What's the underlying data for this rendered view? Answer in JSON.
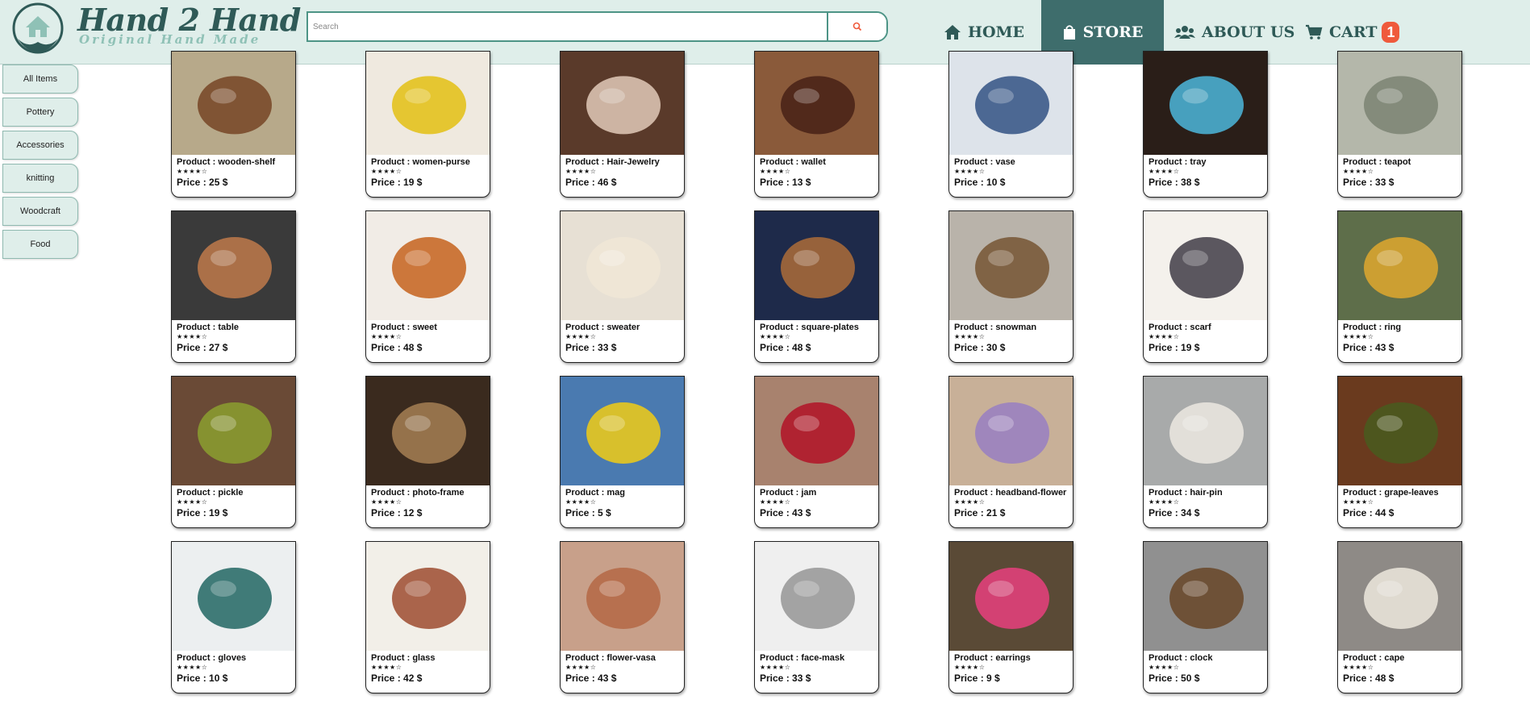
{
  "brand": {
    "title": "Hand 2 Hand",
    "tagline": "Original Hand Made"
  },
  "search": {
    "placeholder": "Search",
    "value": ""
  },
  "nav": {
    "home": "HOME",
    "store": "STORE",
    "about": "ABOUT US",
    "cart": "CART",
    "cart_count": "1",
    "active": "STORE"
  },
  "categories": [
    "All Items",
    "Pottery",
    "Accessories",
    "knitting",
    "Woodcraft",
    "Food"
  ],
  "product_prefix": "Product : ",
  "price_prefix": "Price : ",
  "currency": "$",
  "rating_stars": "★★★★☆",
  "colors": {
    "header_bg": "#dfeeea",
    "brand_dark": "#2f5a57",
    "active_nav": "#3e6d6c",
    "badge": "#ef5a3c",
    "accent": "#4d9486"
  },
  "products": [
    {
      "name": "wooden-shelf",
      "price": 25,
      "rating": 4,
      "image": "wooden-shelf"
    },
    {
      "name": "women-purse",
      "price": 19,
      "rating": 4,
      "image": "women-purse"
    },
    {
      "name": "Hair-Jewelry",
      "price": 46,
      "rating": 4,
      "image": "hair-jewelry"
    },
    {
      "name": "wallet",
      "price": 13,
      "rating": 4,
      "image": "wallet"
    },
    {
      "name": "vase",
      "price": 10,
      "rating": 4,
      "image": "vase"
    },
    {
      "name": "tray",
      "price": 38,
      "rating": 4,
      "image": "tray"
    },
    {
      "name": "teapot",
      "price": 33,
      "rating": 4,
      "image": "teapot"
    },
    {
      "name": "table",
      "price": 27,
      "rating": 4,
      "image": "table"
    },
    {
      "name": "sweet",
      "price": 48,
      "rating": 4,
      "image": "sweet"
    },
    {
      "name": "sweater",
      "price": 33,
      "rating": 4,
      "image": "sweater"
    },
    {
      "name": "square-plates",
      "price": 48,
      "rating": 4,
      "image": "square-plates"
    },
    {
      "name": "snowman",
      "price": 30,
      "rating": 4,
      "image": "snowman"
    },
    {
      "name": "scarf",
      "price": 19,
      "rating": 4,
      "image": "scarf"
    },
    {
      "name": "ring",
      "price": 43,
      "rating": 4,
      "image": "ring"
    },
    {
      "name": "pickle",
      "price": 19,
      "rating": 4,
      "image": "pickle"
    },
    {
      "name": "photo-frame",
      "price": 12,
      "rating": 4,
      "image": "photo-frame"
    },
    {
      "name": "mag",
      "price": 5,
      "rating": 4,
      "image": "mag"
    },
    {
      "name": "jam",
      "price": 43,
      "rating": 4,
      "image": "jam"
    },
    {
      "name": "headband-flower",
      "price": 21,
      "rating": 4,
      "image": "headband-flower"
    },
    {
      "name": "hair-pin",
      "price": 34,
      "rating": 4,
      "image": "hair-pin"
    },
    {
      "name": "grape-leaves",
      "price": 44,
      "rating": 4,
      "image": "grape-leaves"
    },
    {
      "name": "gloves",
      "price": 10,
      "rating": 4,
      "image": "gloves"
    },
    {
      "name": "glass",
      "price": 42,
      "rating": 4,
      "image": "glass"
    },
    {
      "name": "flower-vasa",
      "price": 43,
      "rating": 4,
      "image": "flower-vasa"
    },
    {
      "name": "face-mask",
      "price": 33,
      "rating": 4,
      "image": "face-mask"
    },
    {
      "name": "earrings",
      "price": 9,
      "rating": 4,
      "image": "earrings"
    },
    {
      "name": "clock",
      "price": 50,
      "rating": 4,
      "image": "clock"
    },
    {
      "name": "cape",
      "price": 48,
      "rating": 4,
      "image": "cape"
    }
  ]
}
